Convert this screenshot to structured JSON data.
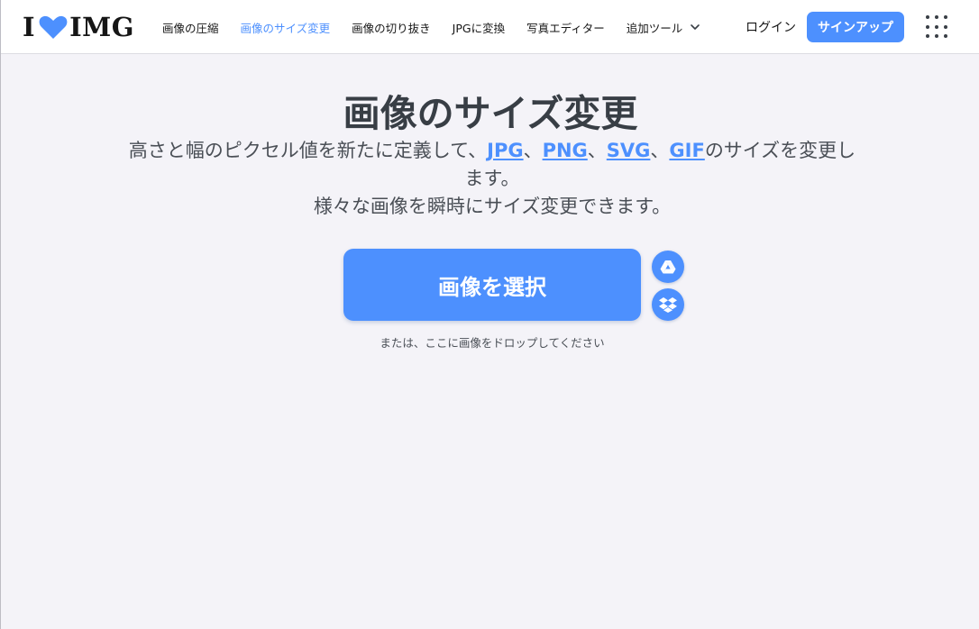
{
  "header": {
    "logo": {
      "left": "I",
      "right": "IMG"
    },
    "nav": [
      {
        "label": "画像の圧縮"
      },
      {
        "label": "画像のサイズ変更",
        "active": true
      },
      {
        "label": "画像の切り抜き"
      },
      {
        "label": "JPGに変換"
      },
      {
        "label": "写真エディター"
      },
      {
        "label": "追加ツール"
      }
    ],
    "login": "ログイン",
    "signup": "サインアップ"
  },
  "main": {
    "title": "画像のサイズ変更",
    "description": {
      "part1": "高さと幅のピクセル値を新たに定義して、",
      "jpg": "JPG",
      "sep1": "、",
      "png": "PNG",
      "sep2": "、",
      "svg": "SVG",
      "sep3": "、",
      "gif": "GIF",
      "part2": "のサイズを変更します。",
      "line2": "様々な画像を瞬時にサイズ変更できます。"
    },
    "select_button": "画像を選択",
    "drop_hint": "または、ここに画像をドロップしてください"
  },
  "icons": {
    "logo_heart": "heart-icon",
    "more_tools": "chevron-down-icon",
    "apps": "grid-icon",
    "google_drive": "google-drive-icon",
    "dropbox": "dropbox-icon"
  },
  "colors": {
    "accent": "#4d90fe",
    "background": "#f4f3f8",
    "text": "#383e45"
  }
}
